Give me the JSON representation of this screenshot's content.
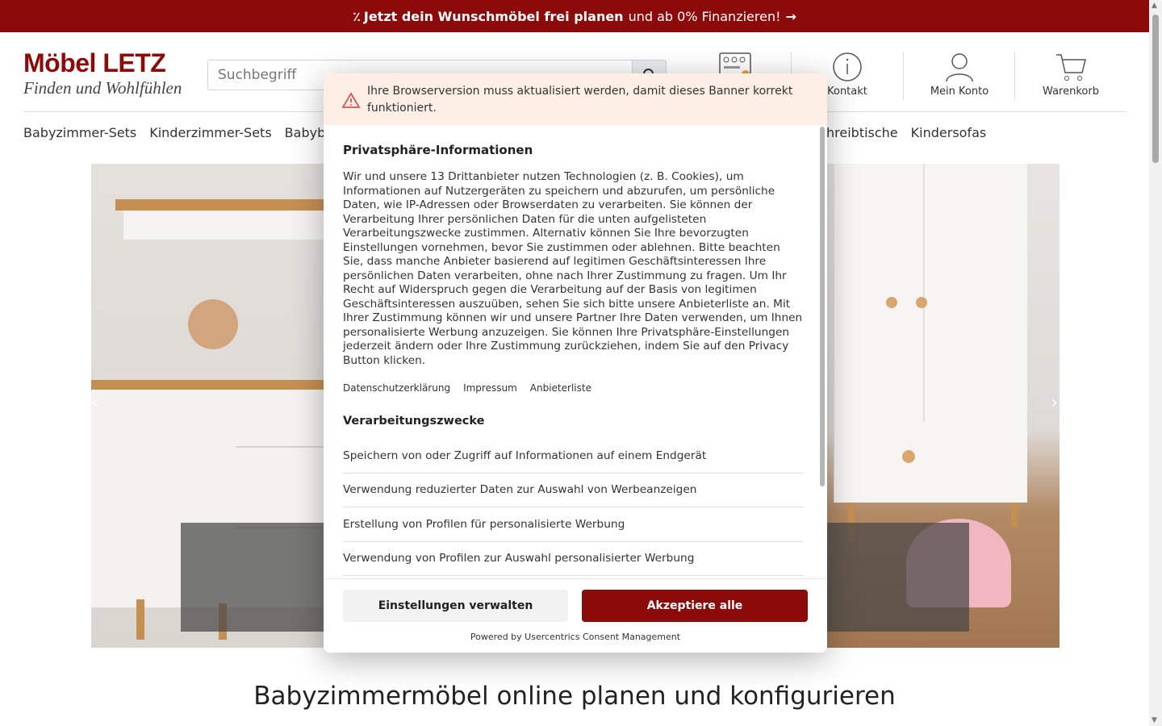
{
  "promo": {
    "icon": "percent-icon",
    "bold_text": "Jetzt dein Wunschmöbel frei planen",
    "text": "und ab 0% Finanzieren!",
    "arrow": "→"
  },
  "logo": {
    "brand": "Möbel LETZ",
    "tagline": "Finden und Wohlfühlen"
  },
  "search": {
    "placeholder": "Suchbegriff"
  },
  "header_icons": [
    {
      "label": "",
      "icon": "planner-icon"
    },
    {
      "label": "Kontakt",
      "icon": "info-icon"
    },
    {
      "label": "Mein Konto",
      "icon": "user-icon"
    },
    {
      "label": "Warenkorb",
      "icon": "cart-icon"
    }
  ],
  "nav": {
    "items": [
      "Babyzimmer-Sets",
      "Kinderzimmer-Sets",
      "Babyb"
    ],
    "items_right": [
      "hreibtische",
      "Kindersofas"
    ]
  },
  "hero": {
    "prev_arrow": "‹",
    "next_arrow": "›"
  },
  "page_heading": "Babyzimmermöbel online planen und konfigurieren",
  "consent": {
    "warning": "Ihre Browserversion muss aktualisiert werden, damit dieses Banner korrekt funktioniert.",
    "title": "Privatsphäre-Informationen",
    "text": "Wir und unsere 13 Drittanbieter nutzen Technologien (z. B. Cookies), um Informationen auf Nutzergeräten zu speichern und abzurufen, um persönliche Daten, wie IP-Adressen oder Browserdaten zu verarbeiten. Sie können der Verarbeitung Ihrer persönlichen Daten für die unten aufgelisteten Verarbeitungszwecke zustimmen. Alternativ können Sie Ihre bevorzugten Einstellungen vornehmen, bevor Sie zustimmen oder ablehnen. Bitte beachten Sie, dass manche Anbieter basierend auf legitimen Geschäftsinteressen Ihre persönlichen Daten verarbeiten, ohne nach Ihrer Zustimmung zu fragen. Um Ihr Recht auf Widerspruch gegen die Verarbeitung auf der Basis von legitimen Geschäftsinteressen auszuüben, sehen Sie sich bitte unsere Anbieterliste an. Mit Ihrer Zustimmung können wir und unsere Partner Ihre Daten verwenden, um Ihnen personalisierte Werbung anzuzeigen. Sie können Ihre Privatsphäre-Einstellungen jederzeit ändern oder Ihre Zustimmung zurückziehen, indem Sie auf den Privacy Button klicken.",
    "links": [
      "Datenschutzerklärung",
      "Impressum",
      "Anbieterliste"
    ],
    "purposes_title": "Verarbeitungszwecke",
    "purposes": [
      "Speichern von oder Zugriff auf Informationen auf einem Endgerät",
      "Verwendung reduzierter Daten zur Auswahl von Werbeanzeigen",
      "Erstellung von Profilen für personalisierte Werbung",
      "Verwendung von Profilen zur Auswahl personalisierter Werbung"
    ],
    "manage_button": "Einstellungen verwalten",
    "accept_button": "Akzeptiere alle",
    "powered_by": "Powered by Usercentrics Consent Management"
  },
  "colors": {
    "brand": "#8c0a0a",
    "warning_bg": "#fdeee6"
  }
}
